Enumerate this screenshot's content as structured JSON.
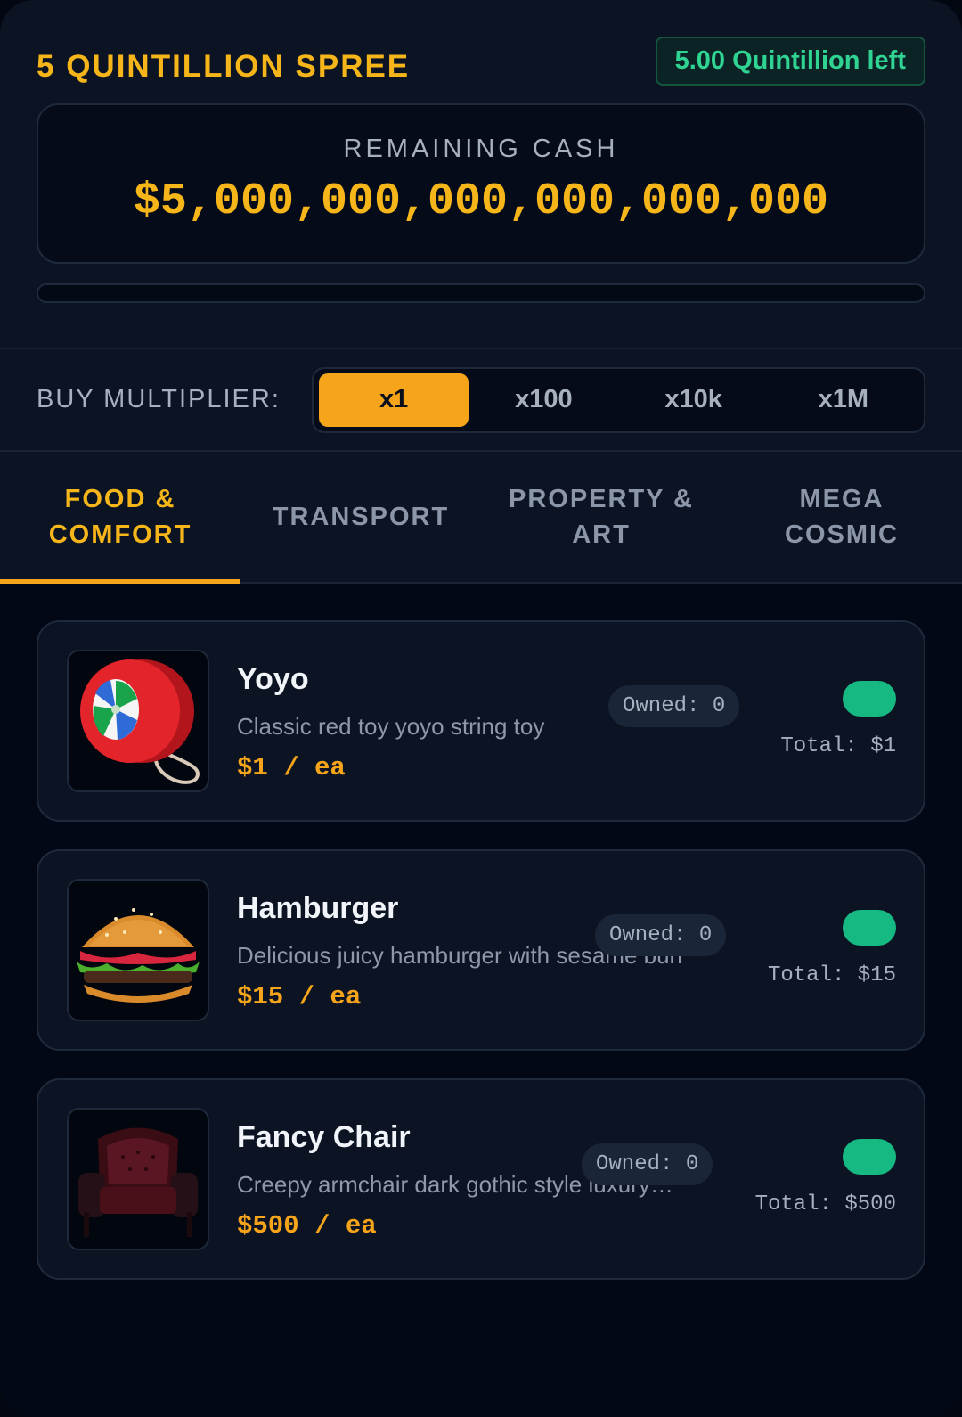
{
  "header": {
    "title": "5 QUINTILLION SPREE",
    "badge": "5.00 Quintillion left",
    "cash_label": "REMAINING CASH",
    "cash_value": "$5,000,000,000,000,000,000",
    "spent_fraction": 0
  },
  "multiplier": {
    "label": "BUY MULTIPLIER:",
    "options": [
      "x1",
      "x100",
      "x10k",
      "x1M"
    ],
    "selected": "x1"
  },
  "tabs": [
    {
      "label": "FOOD & COMFORT",
      "active": true
    },
    {
      "label": "TRANSPORT",
      "active": false
    },
    {
      "label": "PROPERTY & ART",
      "active": false
    },
    {
      "label": "MEGA COSMIC",
      "active": false
    }
  ],
  "items": [
    {
      "name": "Yoyo",
      "description": "Classic red toy yoyo string toy",
      "price": "$1 / ea",
      "owned": "Owned: 0",
      "total": "Total: $1",
      "image": "yoyo-image"
    },
    {
      "name": "Hamburger",
      "description": "Delicious juicy hamburger with sesame bun",
      "price": "$15 / ea",
      "owned": "Owned: 0",
      "total": "Total: $15",
      "image": "hamburger-image"
    },
    {
      "name": "Fancy Chair",
      "description": "Creepy armchair dark gothic style luxury…",
      "price": "$500 / ea",
      "owned": "Owned: 0",
      "total": "Total: $500",
      "image": "armchair-image"
    }
  ],
  "colors": {
    "accent": "#f6a41a",
    "buy_button": "#16b981",
    "badge_text": "#2fd392"
  }
}
